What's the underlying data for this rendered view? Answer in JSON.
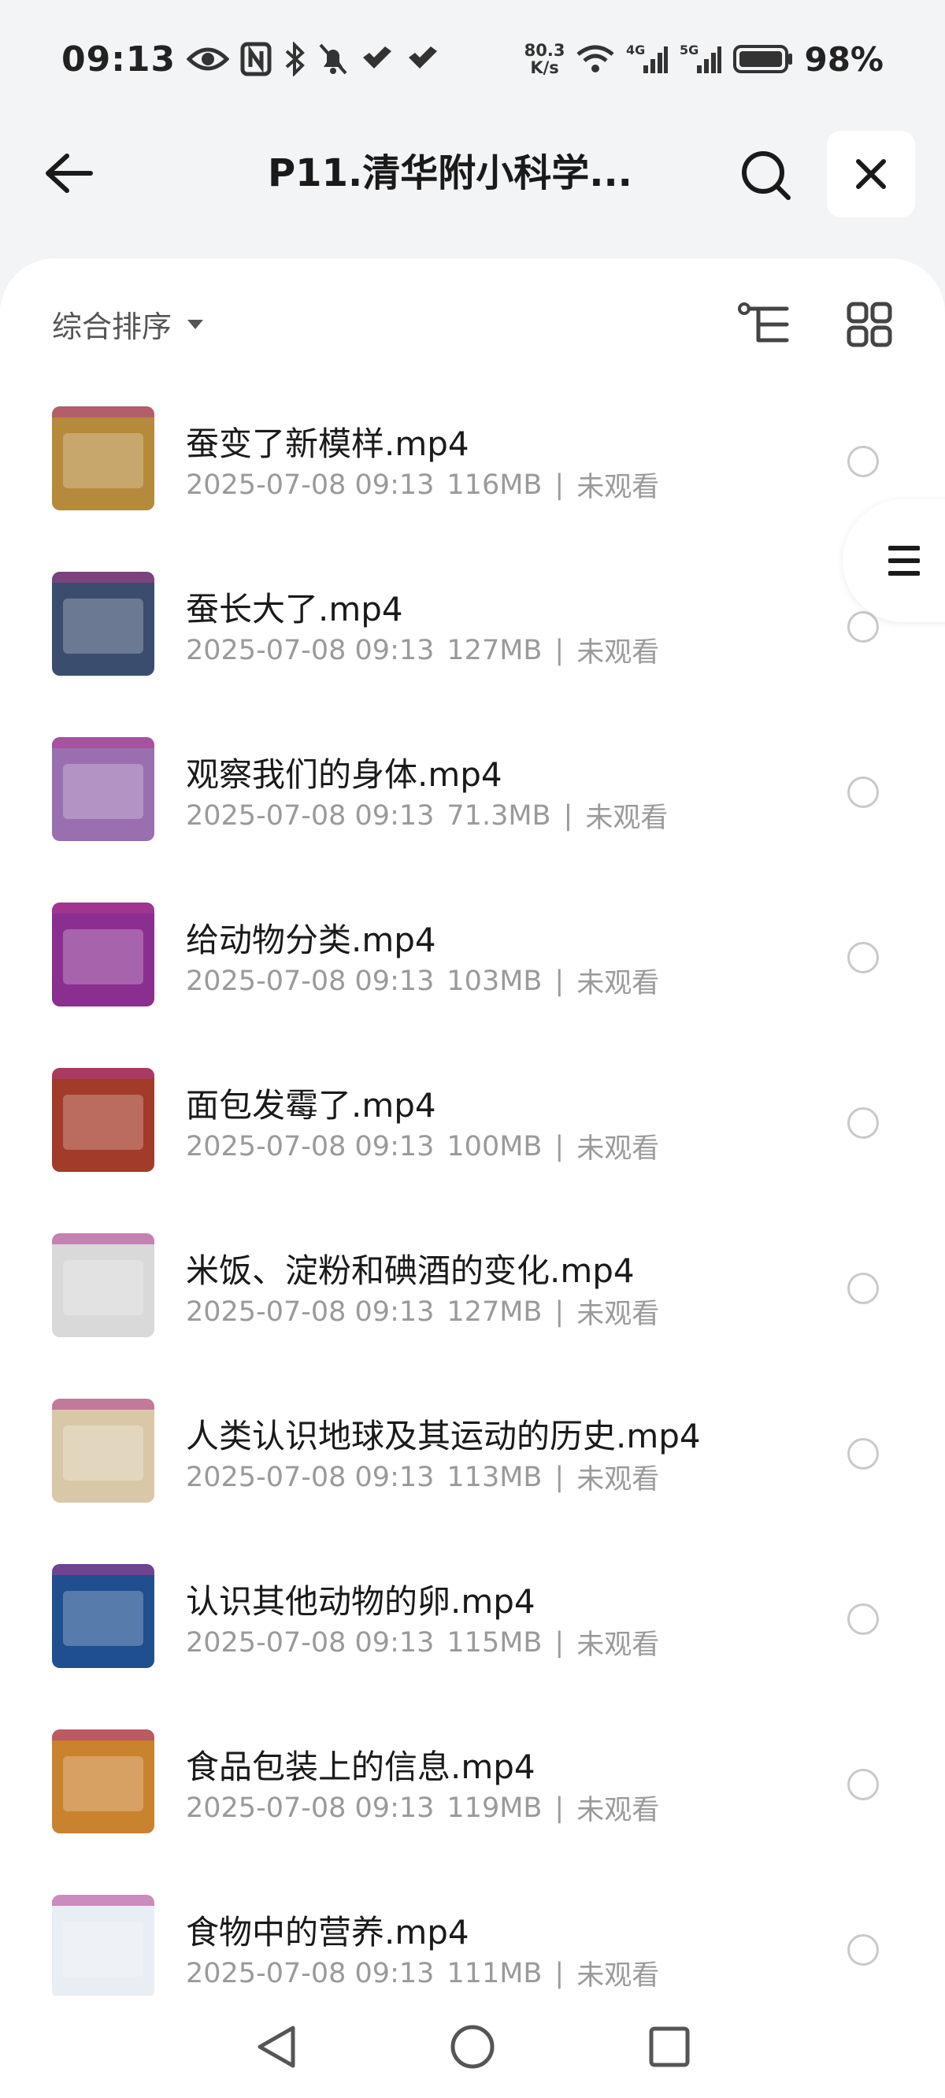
{
  "status_bar": {
    "time": "09:13",
    "net_speed_value": "80.3",
    "net_speed_unit": "K/s",
    "network_4g": "4G",
    "network_5g": "5G",
    "battery": "98%"
  },
  "header": {
    "title": "P11.清华附小科学..."
  },
  "sort": {
    "label": "综合排序"
  },
  "files": [
    {
      "name": "蚕变了新模样.mp4",
      "date": "2025-07-08 09:13",
      "size": "116MB",
      "status": "未观看",
      "thumb_color": "#b58a3a"
    },
    {
      "name": "蚕长大了.mp4",
      "date": "2025-07-08 09:13",
      "size": "127MB",
      "status": "未观看",
      "thumb_color": "#3a4d6e"
    },
    {
      "name": "观察我们的身体.mp4",
      "date": "2025-07-08 09:13",
      "size": "71.3MB",
      "status": "未观看",
      "thumb_color": "#9a6fb0"
    },
    {
      "name": "给动物分类.mp4",
      "date": "2025-07-08 09:13",
      "size": "103MB",
      "status": "未观看",
      "thumb_color": "#8a2f8f"
    },
    {
      "name": "面包发霉了.mp4",
      "date": "2025-07-08 09:13",
      "size": "100MB",
      "status": "未观看",
      "thumb_color": "#a33b2a"
    },
    {
      "name": "米饭、淀粉和碘酒的变化.mp4",
      "date": "2025-07-08 09:13",
      "size": "127MB",
      "status": "未观看",
      "thumb_color": "#d9d9d9"
    },
    {
      "name": "人类认识地球及其运动的历史.mp4",
      "date": "2025-07-08 09:13",
      "size": "113MB",
      "status": "未观看",
      "thumb_color": "#d8c8a8"
    },
    {
      "name": "认识其他动物的卵.mp4",
      "date": "2025-07-08 09:13",
      "size": "115MB",
      "status": "未观看",
      "thumb_color": "#1f4f8f"
    },
    {
      "name": "食品包装上的信息.mp4",
      "date": "2025-07-08 09:13",
      "size": "119MB",
      "status": "未观看",
      "thumb_color": "#c9822e"
    },
    {
      "name": "食物中的营养.mp4",
      "date": "2025-07-08 09:13",
      "size": "111MB",
      "status": "未观看",
      "thumb_color": "#e8eef3"
    }
  ],
  "theme": {
    "background": "#f3f4f6",
    "panel": "#ffffff",
    "meta_text": "#9a9a9a"
  }
}
